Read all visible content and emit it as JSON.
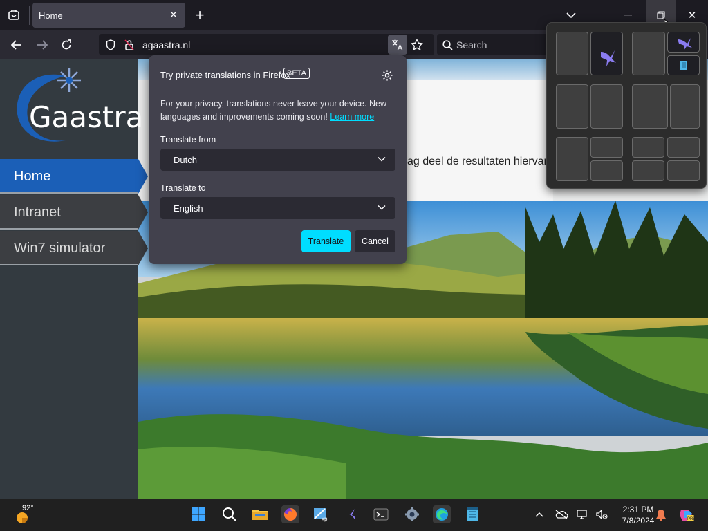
{
  "browser": {
    "tab_title": "Home",
    "url": "agaastra.nl",
    "search_placeholder": "Search"
  },
  "site": {
    "logo_text": "Gaastra",
    "nav": [
      {
        "label": "Home",
        "active": true
      },
      {
        "label": "Intranet",
        "active": false
      },
      {
        "label": "Win7 simulator",
        "active": false
      }
    ],
    "content_text": "ag deel de resultaten hiervan"
  },
  "translation_popup": {
    "title": "Try private translations in Firefox",
    "badge": "BETA",
    "description": "For your privacy, translations never leave your device. New languages and improvements coming soon!",
    "learn_more": "Learn more",
    "from_label": "Translate from",
    "from_value": "Dutch",
    "to_label": "Translate to",
    "to_value": "English",
    "translate_button": "Translate",
    "cancel_button": "Cancel"
  },
  "taskbar": {
    "weather_temp": "92°",
    "time": "2:31 PM",
    "date": "7/8/2024"
  },
  "colors": {
    "accent": "#00ddff",
    "nav_active": "#1b5fb7"
  }
}
